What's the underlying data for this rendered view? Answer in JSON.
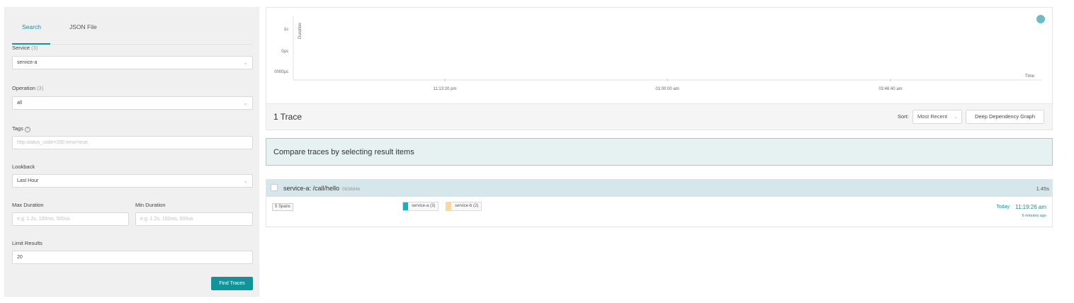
{
  "colors": {
    "accent": "#11939a",
    "service_a": "#11b3c0",
    "service_b": "#fcd89e",
    "chart_dot": "#6bbcc6"
  },
  "search": {
    "tabs": [
      {
        "label": "Search",
        "active": true
      },
      {
        "label": "JSON File",
        "active": false
      }
    ],
    "service": {
      "label": "Service",
      "count": "(3)",
      "value": "service-a"
    },
    "operation": {
      "label": "Operation",
      "count": "(3)",
      "value": "all"
    },
    "tags": {
      "label": "Tags",
      "placeholder": "http.status_code=200 error=true"
    },
    "lookback": {
      "label": "Lookback",
      "value": "Last Hour"
    },
    "max_duration": {
      "label": "Max Duration",
      "placeholder": "e.g. 1.2s, 100ms, 500us"
    },
    "min_duration": {
      "label": "Min Duration",
      "placeholder": "e.g. 1.2s, 100ms, 500us"
    },
    "limit": {
      "label": "Limit Results",
      "value": "20"
    },
    "find_button": "Find Traces"
  },
  "chart": {
    "y_axis_label": "Duration",
    "y_ticks": [
      "1s",
      "0μs",
      "0000μs"
    ],
    "x_axis_label": "Time",
    "x_ticks": [
      "11:13:20 pm",
      "01:00:00 am",
      "03:46:40 am"
    ]
  },
  "results": {
    "count_label": "1 Trace",
    "sort_label": "Sort:",
    "sort_value": "Most Recent",
    "ddg_button": "Deep Dependency Graph"
  },
  "compare_banner": "Compare traces by selecting result items",
  "trace": {
    "name": "service-a: /call/hello",
    "id": "083884b",
    "duration": "1.45s",
    "spans": "5 Spans",
    "services": [
      {
        "name": "service-a (3)"
      },
      {
        "name": "service-b (2)"
      }
    ],
    "date": "Today",
    "time": "11:19:26 am",
    "ago": "6 minutes ago"
  }
}
